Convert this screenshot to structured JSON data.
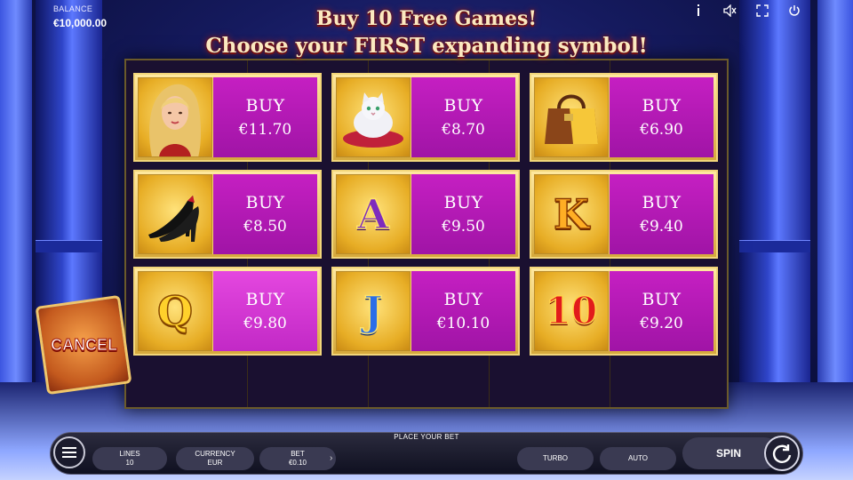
{
  "balance": {
    "label": "BALANCE",
    "value": "€10,000.00"
  },
  "top_icons": [
    "info-icon",
    "sound-icon",
    "fullscreen-icon",
    "power-icon"
  ],
  "headline": {
    "line1": "Buy 10 Free Games!",
    "line2": "Choose your FIRST expanding symbol!"
  },
  "cards": [
    {
      "symbol": "woman-portrait",
      "symbol_icon": "woman-icon",
      "buy_label": "BUY",
      "price": "€11.70"
    },
    {
      "symbol": "white-cat",
      "symbol_icon": "cat-icon",
      "buy_label": "BUY",
      "price": "€8.70"
    },
    {
      "symbol": "handbag",
      "symbol_icon": "handbag-icon",
      "buy_label": "BUY",
      "price": "€6.90"
    },
    {
      "symbol": "high-heels",
      "symbol_icon": "high-heel-icon",
      "buy_label": "BUY",
      "price": "€8.50"
    },
    {
      "symbol": "A",
      "symbol_icon": "letter-a-icon",
      "buy_label": "BUY",
      "price": "€9.50"
    },
    {
      "symbol": "K",
      "symbol_icon": "letter-k-icon",
      "buy_label": "BUY",
      "price": "€9.40"
    },
    {
      "symbol": "Q",
      "symbol_icon": "letter-q-icon",
      "buy_label": "BUY",
      "price": "€9.80"
    },
    {
      "symbol": "J",
      "symbol_icon": "letter-j-icon",
      "buy_label": "BUY",
      "price": "€10.10"
    },
    {
      "symbol": "10",
      "symbol_icon": "ten-icon",
      "buy_label": "BUY",
      "price": "€9.20"
    }
  ],
  "highlighted_card": 6,
  "cancel_label": "CANCEL",
  "bottom_bar": {
    "place_bet": "PLACE YOUR BET",
    "lines_label": "LINES",
    "lines_value": "10",
    "currency_label": "CURRENCY",
    "currency_value": "EUR",
    "bet_label": "BET",
    "bet_value": "€0.10",
    "turbo_label": "TURBO",
    "auto_label": "AUTO",
    "spin_label": "SPIN"
  },
  "colors": {
    "card_purple": "#a014a6",
    "card_gold": "#e7ad25",
    "headline": "#fbe9c0"
  }
}
